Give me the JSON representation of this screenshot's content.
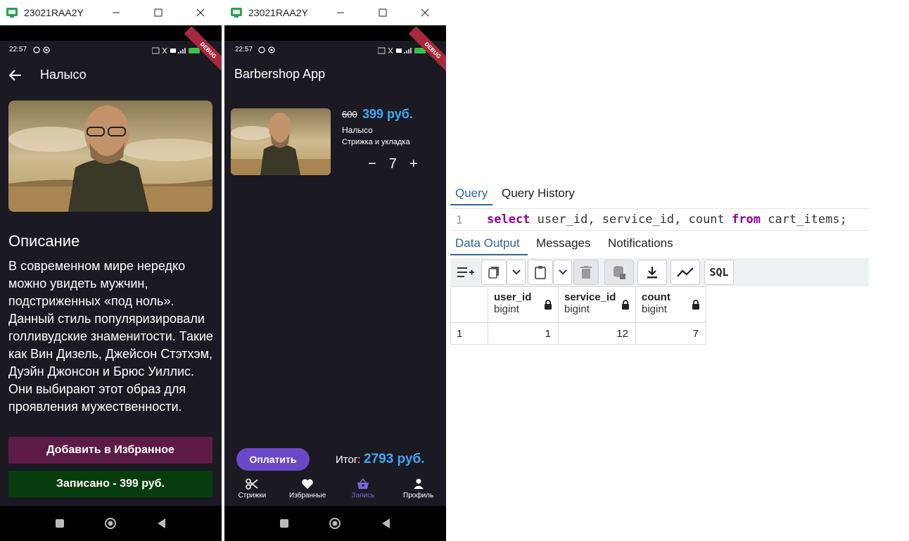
{
  "left_window": {
    "title": "23021RAA2Y",
    "status_time": "22:57",
    "debug_label": "DEBUG",
    "appbar_title": "Налысо",
    "description_title": "Описание",
    "description_text": "В современном мире нередко можно увидеть мужчин, подстриженных «под ноль». Данный стиль популяризировали голливудские знаменитости. Такие как Вин Дизель, Джейсон Стэтхэм, Дуэйн Джонсон и Брюс Уиллис. Они выбирают этот образ для проявления мужественности.",
    "favorite_button": "Добавить в Избранное",
    "recorded_button": "Записано - 399 руб."
  },
  "right_window": {
    "title": "23021RAA2Y",
    "status_time": "22:57",
    "debug_label": "DEBUG",
    "appbar_title": "Barbershop App",
    "cart_item": {
      "old_price": "600",
      "new_price": "399 руб.",
      "name": "Налысо",
      "subtitle": "Стрижка и укладка",
      "minus": "−",
      "quantity": "7",
      "plus": "+"
    },
    "pay_button": "Оплатить",
    "total_label": "Итог:",
    "total_value": "2793 руб.",
    "bottom_nav": [
      {
        "label": "Стрижки",
        "icon": "scissors-icon",
        "active": false
      },
      {
        "label": "Избранные",
        "icon": "heart-icon",
        "active": false
      },
      {
        "label": "Запись",
        "icon": "basket-icon",
        "active": true
      },
      {
        "label": "Профиль",
        "icon": "person-icon",
        "active": false
      }
    ]
  },
  "pgadmin": {
    "top_tabs": [
      "Query",
      "Query History"
    ],
    "sql": {
      "line_number": "1",
      "kw_select": "select",
      "cols": "user_id, service_id, count",
      "kw_from": "from",
      "table": "cart_items;"
    },
    "output_tabs": [
      "Data Output",
      "Messages",
      "Notifications"
    ],
    "toolbar_sql_label": "SQL",
    "columns": [
      {
        "name": "user_id",
        "type": "bigint"
      },
      {
        "name": "service_id",
        "type": "bigint"
      },
      {
        "name": "count",
        "type": "bigint"
      }
    ],
    "rows": [
      {
        "row_num": "1",
        "values": [
          "1",
          "12",
          "7"
        ]
      }
    ]
  },
  "colors": {
    "app_bg": "#1b1a22",
    "price_blue": "#3fa9f5",
    "accent_purple": "#6a49c7",
    "favorite_button": "#5c1b47",
    "recorded_button": "#073d0e",
    "pg_keyword": "#900090",
    "pg_tab_active": "#326690"
  }
}
